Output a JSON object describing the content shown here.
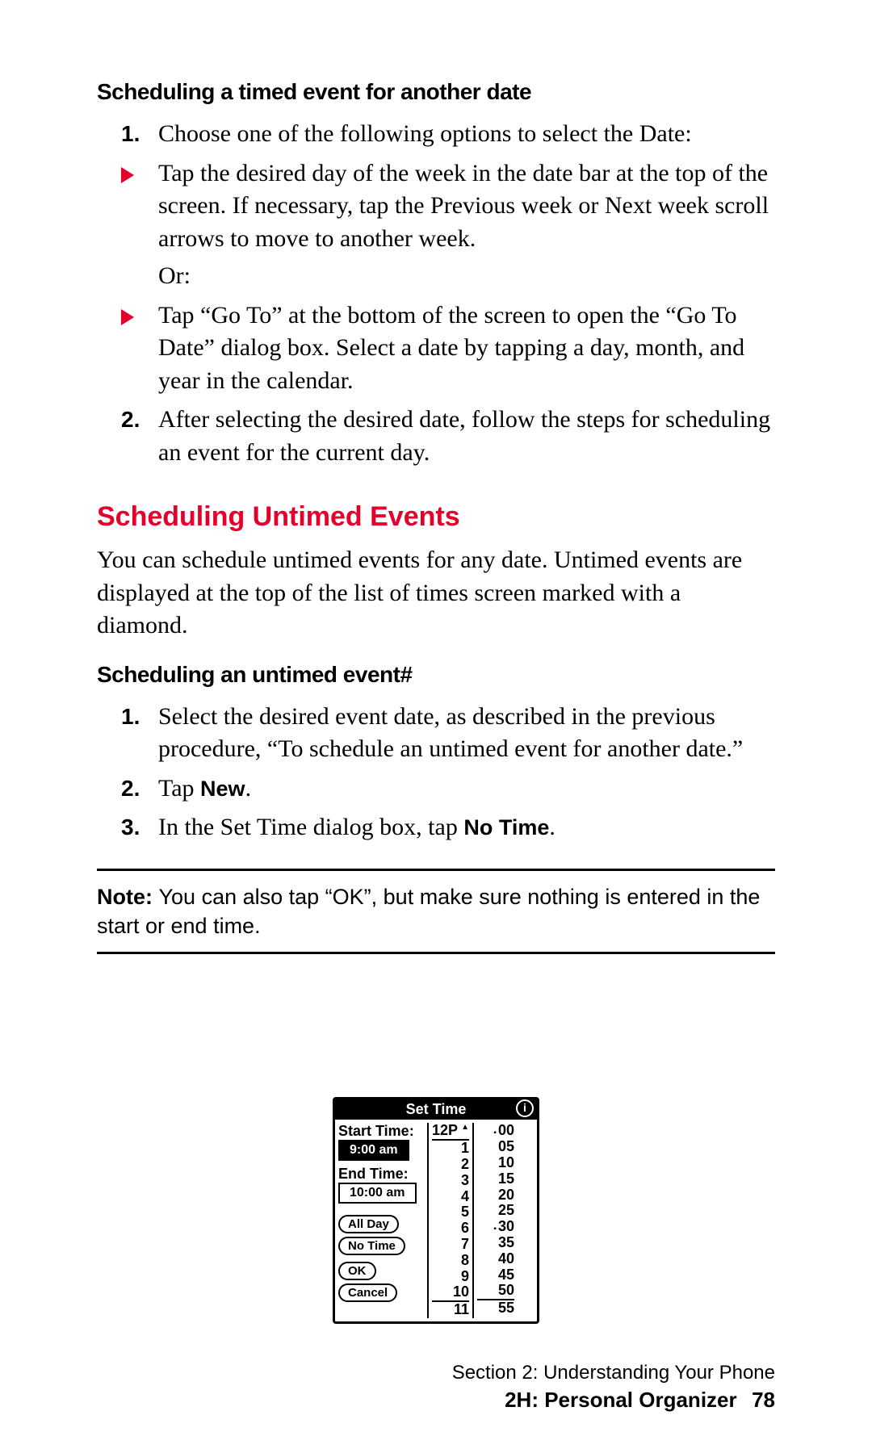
{
  "sec1": {
    "title": "Scheduling a timed event for another date",
    "step1_marker": "1.",
    "step1_text": "Choose one of the following options to select the Date:",
    "opt1": "Tap the desired day of the week in the date bar at the top of the screen. If necessary, tap the Previous week or Next week scroll arrows to move to another week.",
    "or": "Or:",
    "opt2": "Tap “Go To” at the bottom of the screen to open the “Go To Date” dialog box. Select a date by tapping a day, month, and year in the calendar.",
    "step2_marker": "2.",
    "step2_text": "After selecting the desired date, follow the steps for scheduling an event for the current day."
  },
  "sec2": {
    "title": "Scheduling Untimed Events",
    "para": "You can schedule untimed events for any date. Untimed events are displayed at the top of the list of times screen marked with a diamond.",
    "subtitle": "Scheduling an untimed event#",
    "s1_marker": "1.",
    "s1_text": "Select the desired event date, as described in the previous procedure, “To schedule an untimed event for another date.”",
    "s2_marker": "2.",
    "s2_pre": "Tap ",
    "s2_bold": "New",
    "s2_post": ".",
    "s3_marker": "3.",
    "s3_pre": "In the Set Time dialog box, tap ",
    "s3_bold": "No Time",
    "s3_post": "."
  },
  "note": {
    "label": "Note: ",
    "text": "You can also tap “OK”, but make sure nothing is entered in the start or end time."
  },
  "dialog": {
    "title": "Set Time",
    "info": "i",
    "start_label": "Start Time:",
    "start_value": "9:00 am",
    "end_label": "End Time:",
    "end_value": "10:00 am",
    "allday": "All Day",
    "notime": "No Time",
    "ok": "OK",
    "cancel": "Cancel",
    "hours_top": "12P",
    "hours": [
      "1",
      "2",
      "3",
      "4",
      "5",
      "6",
      "7",
      "8",
      "9",
      "10",
      "11"
    ],
    "mins": [
      "00",
      "05",
      "10",
      "15",
      "20",
      "25",
      "30",
      "35",
      "40",
      "45",
      "50",
      "55"
    ]
  },
  "footer": {
    "section": "Section 2: Understanding Your Phone",
    "chapter": "2H: Personal Organizer",
    "page": "78"
  }
}
